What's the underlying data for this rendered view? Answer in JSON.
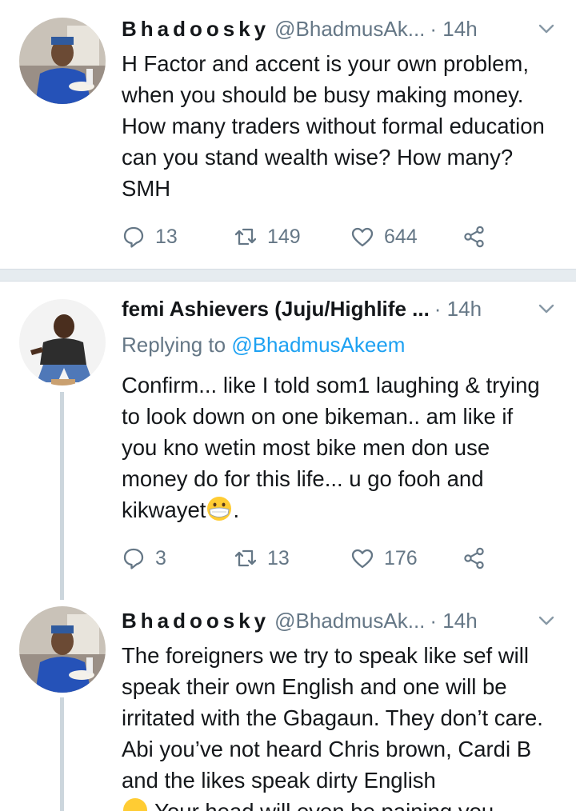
{
  "tweets": [
    {
      "name": "Bhadoosky",
      "handle": "@BhadmusAk...",
      "time": "· 14h",
      "text": "H Factor and accent is your own problem, when you should be busy making money. How many traders without formal education can you stand wealth wise? How many? SMH",
      "replies": "13",
      "retweets": "149",
      "likes": "644",
      "avatar_icon": "user-avatar"
    },
    {
      "name": "femi Ashievers (Juju/Highlife ...",
      "handle": "",
      "time": "· 14h",
      "replying_prefix": "Replying to",
      "replying_to": "@BhadmusAkeem",
      "text": "Confirm...   like I told som1 laughing & trying to look down on one bikeman.. am like if you kno wetin most bike men don use money do for this life...  u go fooh and kikwayet",
      "text_tail": ".",
      "replies": "3",
      "retweets": "13",
      "likes": "176",
      "avatar_icon": "user-avatar",
      "emoji": "mask-face-emoji"
    },
    {
      "name": "Bhadoosky",
      "handle": "@BhadmusAk...",
      "time": "· 14h",
      "text": "The foreigners we try to speak like sef will speak their own English and one will be irritated with the Gbagaun. They don’t care. Abi you’ve not heard Chris brown, Cardi B and the likes speak dirty English",
      "text_cut": "Your head will even be paining you",
      "avatar_icon": "user-avatar"
    }
  ],
  "colors": {
    "text": "#14171a",
    "secondary": "#657786",
    "link": "#1da1f2",
    "divider": "#e6ecf0",
    "thread_line": "#ccd6dd"
  }
}
